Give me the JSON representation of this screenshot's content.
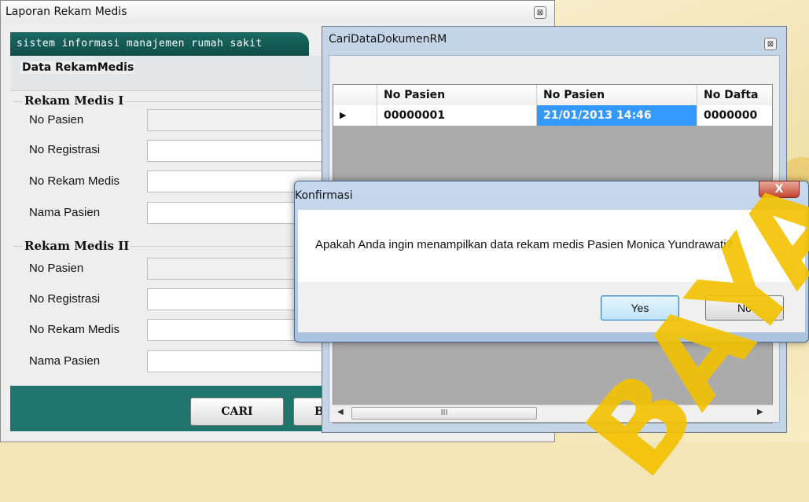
{
  "main_window": {
    "title": "Laporan Rekam Medis",
    "banner": "sistem informasi manajemen rumah sakit",
    "group1": {
      "title": "Rekam Medis I",
      "fields": [
        "No Pasien",
        "No Registrasi",
        "No Rekam Medis",
        "Nama Pasien"
      ]
    },
    "group2": {
      "title": "Rekam Medis II",
      "fields": [
        "No Pasien",
        "No Registrasi",
        "No Rekam Medis",
        "Nama Pasien"
      ]
    },
    "buttons": {
      "cari": "CARI",
      "b": "B"
    }
  },
  "search_window": {
    "title": "CariDataDokumenRM",
    "grid_title": "Data RekamMedis",
    "columns": [
      "No Pasien",
      "No Pasien",
      "No Dafta"
    ],
    "rows": [
      {
        "c1": "00000001",
        "c2": "21/01/2013 14:46",
        "c3": "0000000"
      }
    ],
    "scroll_thumb": "III"
  },
  "dialog": {
    "title": "Konfirmasi",
    "close": "X",
    "message": "Apakah Anda ingin menampilkan data rekam medis Pasien Monica Yundrawati?",
    "yes": "Yes",
    "no": "No"
  },
  "watermark": "BAYA",
  "colors": {
    "teal": "#1f756c",
    "selection": "#3399ff",
    "watermark": "#f3c200"
  }
}
